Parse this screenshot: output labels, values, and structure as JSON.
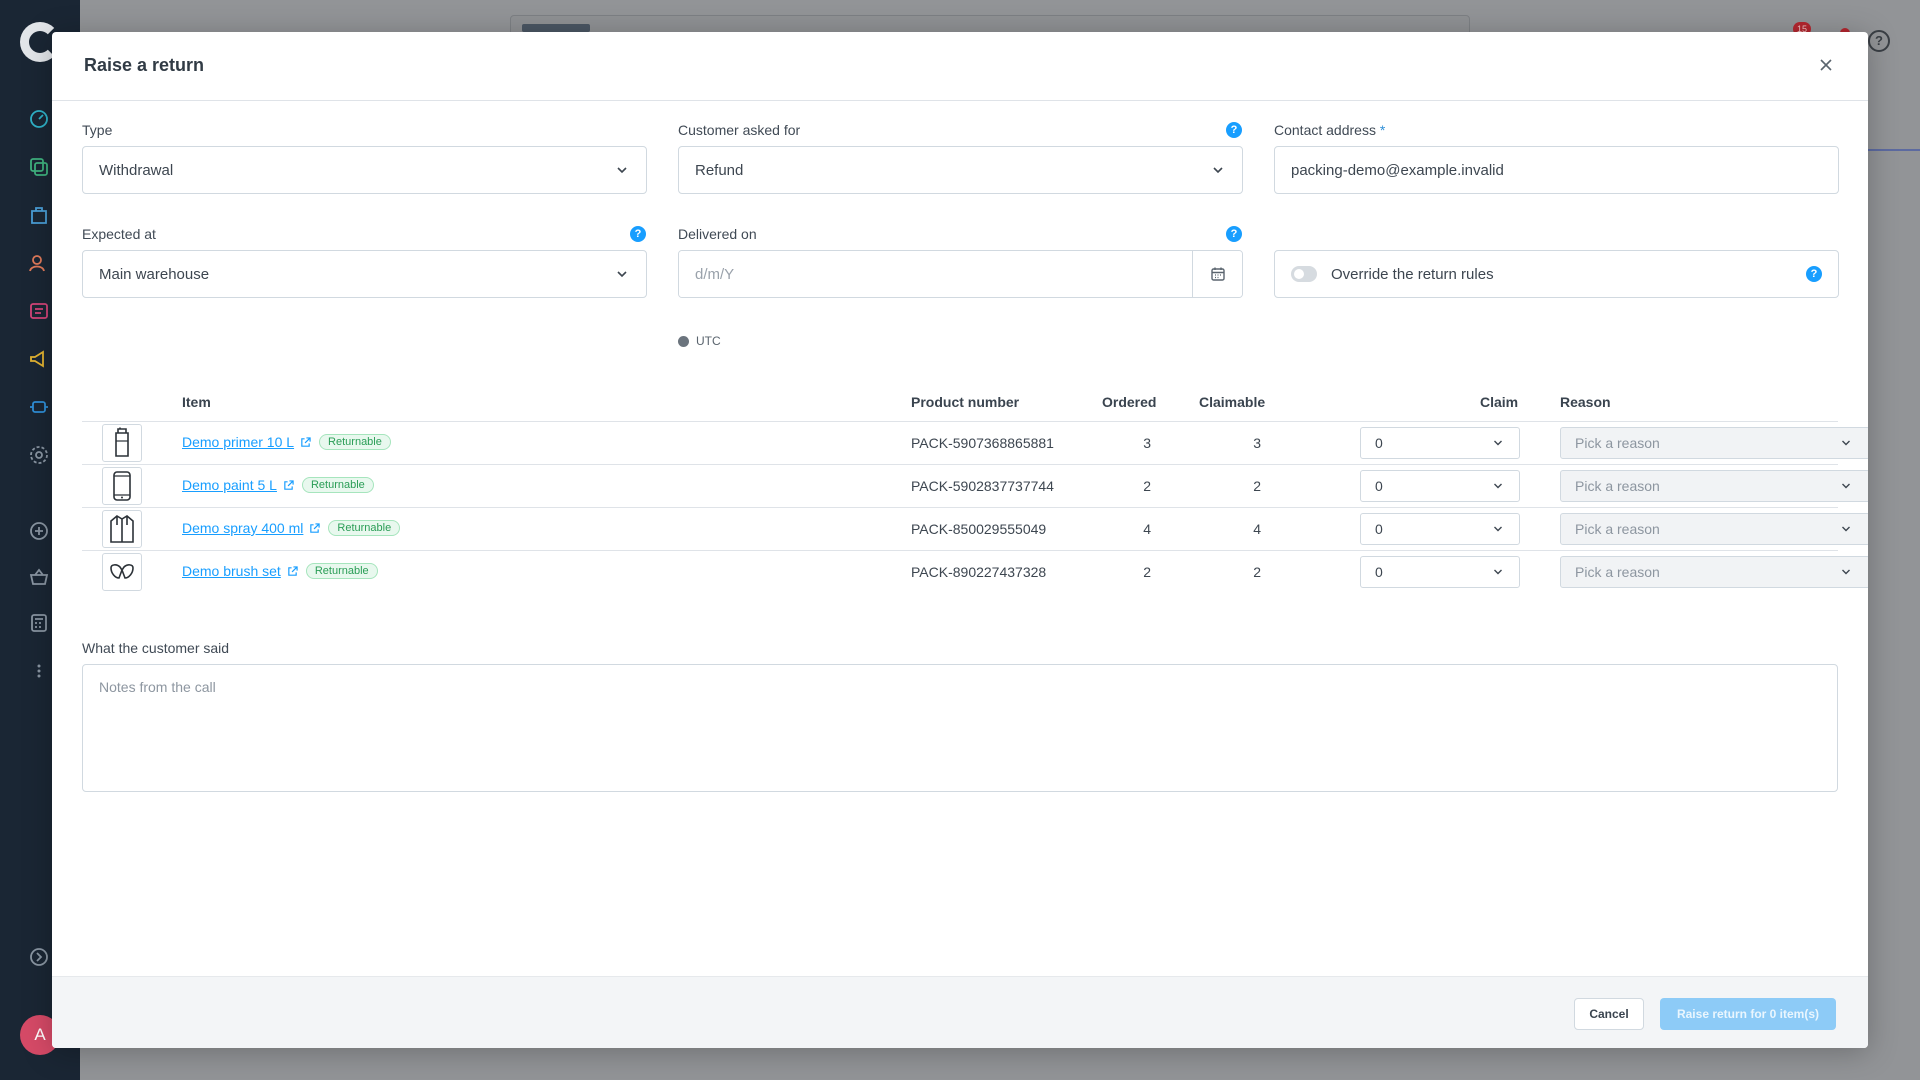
{
  "background": {
    "notification_count": "15",
    "avatar_initial": "A",
    "help_glyph": "?"
  },
  "modal": {
    "title": "Raise a return",
    "close_icon": "close-icon"
  },
  "form": {
    "type": {
      "label": "Type",
      "value": "Withdrawal"
    },
    "customer_asked_for": {
      "label": "Customer asked for",
      "value": "Refund"
    },
    "contact_address": {
      "label": "Contact address",
      "required_mark": "*",
      "value": "packing-demo@example.invalid"
    },
    "expected_at": {
      "label": "Expected at",
      "value": "Main warehouse"
    },
    "delivered_on": {
      "label": "Delivered on",
      "placeholder": "d/m/Y",
      "timezone": "UTC"
    },
    "override": {
      "label": "Override the return rules",
      "enabled": false
    }
  },
  "table": {
    "headers": {
      "item": "Item",
      "product_number": "Product number",
      "ordered": "Ordered",
      "claimable": "Claimable",
      "claim": "Claim",
      "reason": "Reason"
    },
    "rows": [
      {
        "name": "Demo primer 10 L",
        "badge": "Returnable",
        "product_number": "PACK-5907368865881",
        "ordered": "3",
        "claimable": "3",
        "claim": "0",
        "reason_placeholder": "Pick a reason",
        "thumb_icon": "primer-can-icon"
      },
      {
        "name": "Demo paint 5 L",
        "badge": "Returnable",
        "product_number": "PACK-5902837737744",
        "ordered": "2",
        "claimable": "2",
        "claim": "0",
        "reason_placeholder": "Pick a reason",
        "thumb_icon": "phone-icon"
      },
      {
        "name": "Demo spray 400 ml",
        "badge": "Returnable",
        "product_number": "PACK-850029555049",
        "ordered": "4",
        "claimable": "4",
        "claim": "0",
        "reason_placeholder": "Pick a reason",
        "thumb_icon": "jacket-icon"
      },
      {
        "name": "Demo brush set",
        "badge": "Returnable",
        "product_number": "PACK-890227437328",
        "ordered": "2",
        "claimable": "2",
        "claim": "0",
        "reason_placeholder": "Pick a reason",
        "thumb_icon": "gloves-icon"
      }
    ]
  },
  "notes": {
    "label": "What the customer said",
    "placeholder": "Notes from the call"
  },
  "footer": {
    "cancel_label": "Cancel",
    "submit_label": "Raise return for 0 item(s)"
  },
  "colors": {
    "accent": "#189eff",
    "sidebar": "#1a2634",
    "badge_green": "#2a9d56"
  }
}
